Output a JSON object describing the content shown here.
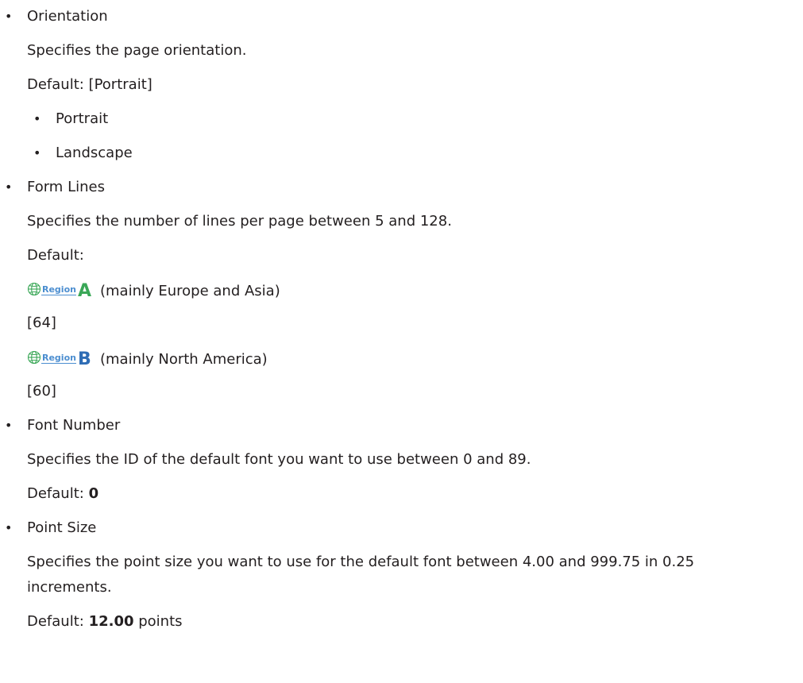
{
  "items": [
    {
      "title": "Orientation",
      "description": "Specifies the page orientation.",
      "default_line": "Default: [Portrait]",
      "options": [
        "Portrait",
        "Landscape"
      ]
    },
    {
      "title": "Form Lines",
      "description": "Specifies the number of lines per page between 5 and 128.",
      "default_label": "Default:",
      "region_a_badge": "Region",
      "region_a_letter": "A",
      "region_a_note": "(mainly Europe and Asia)",
      "region_a_value": "[64]",
      "region_b_badge": "Region",
      "region_b_letter": "B",
      "region_b_note": "(mainly North America)",
      "region_b_value": "[60]"
    },
    {
      "title": "Font Number",
      "description": "Specifies the ID of the default font you want to use between 0 and 89.",
      "default_label": "Default: ",
      "default_value": "0"
    },
    {
      "title": "Point Size",
      "description_line1": "Specifies the point size you want to use for the default font between 4.00 and 999.75 in 0.25",
      "description_line2": "increments.",
      "default_label": "Default: ",
      "default_value": "12.00",
      "default_unit": " points"
    }
  ],
  "colors": {
    "text": "#231f20",
    "region_a": "#3aa757",
    "region_b": "#2f6db5",
    "badge_text": "#4c8ed0"
  }
}
